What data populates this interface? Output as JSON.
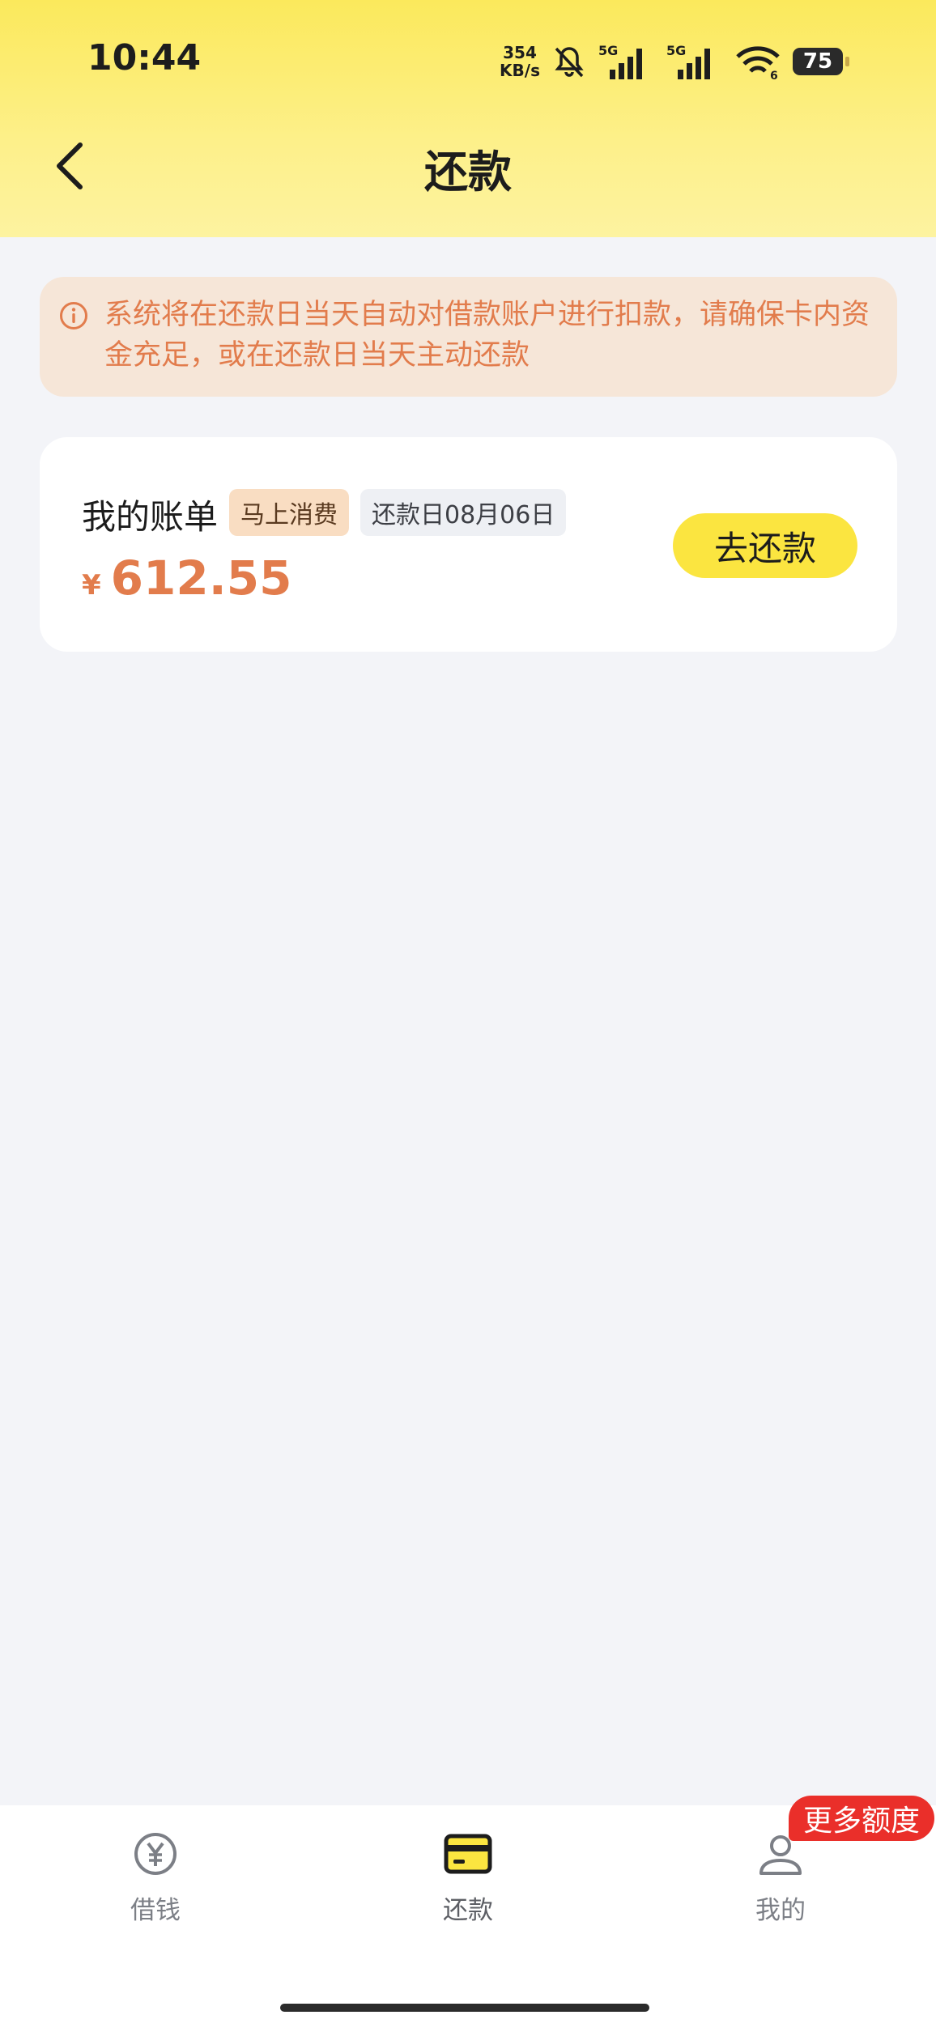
{
  "status_bar": {
    "time": "10:44",
    "net_speed_value": "354",
    "net_speed_unit": "KB/s",
    "signal_1_label": "5G",
    "signal_2_label": "5G",
    "wifi_sub": "6",
    "battery": "75"
  },
  "navbar": {
    "title": "还款",
    "back_icon": "chevron-left-icon"
  },
  "notice": {
    "icon": "info-icon",
    "text": "系统将在还款日当天自动对借款账户进行扣款，请确保卡内资金充足，或在还款日当天主动还款"
  },
  "bill": {
    "title": "我的账单",
    "merchant_tag": "马上消费",
    "due_tag": "还款日08月06日",
    "currency": "¥",
    "amount": "612.55",
    "pay_button": "去还款"
  },
  "tabbar": {
    "tabs": [
      {
        "label": "借钱",
        "icon": "yen-circle-icon",
        "active": false
      },
      {
        "label": "还款",
        "icon": "card-icon",
        "active": true
      },
      {
        "label": "我的",
        "icon": "user-icon",
        "active": false
      }
    ],
    "promo_badge": "更多额度"
  },
  "colors": {
    "header_yellow": "#fbe95c",
    "accent_orange": "#e27c4c",
    "button_yellow": "#fbe540",
    "badge_red": "#ea2f2a"
  }
}
